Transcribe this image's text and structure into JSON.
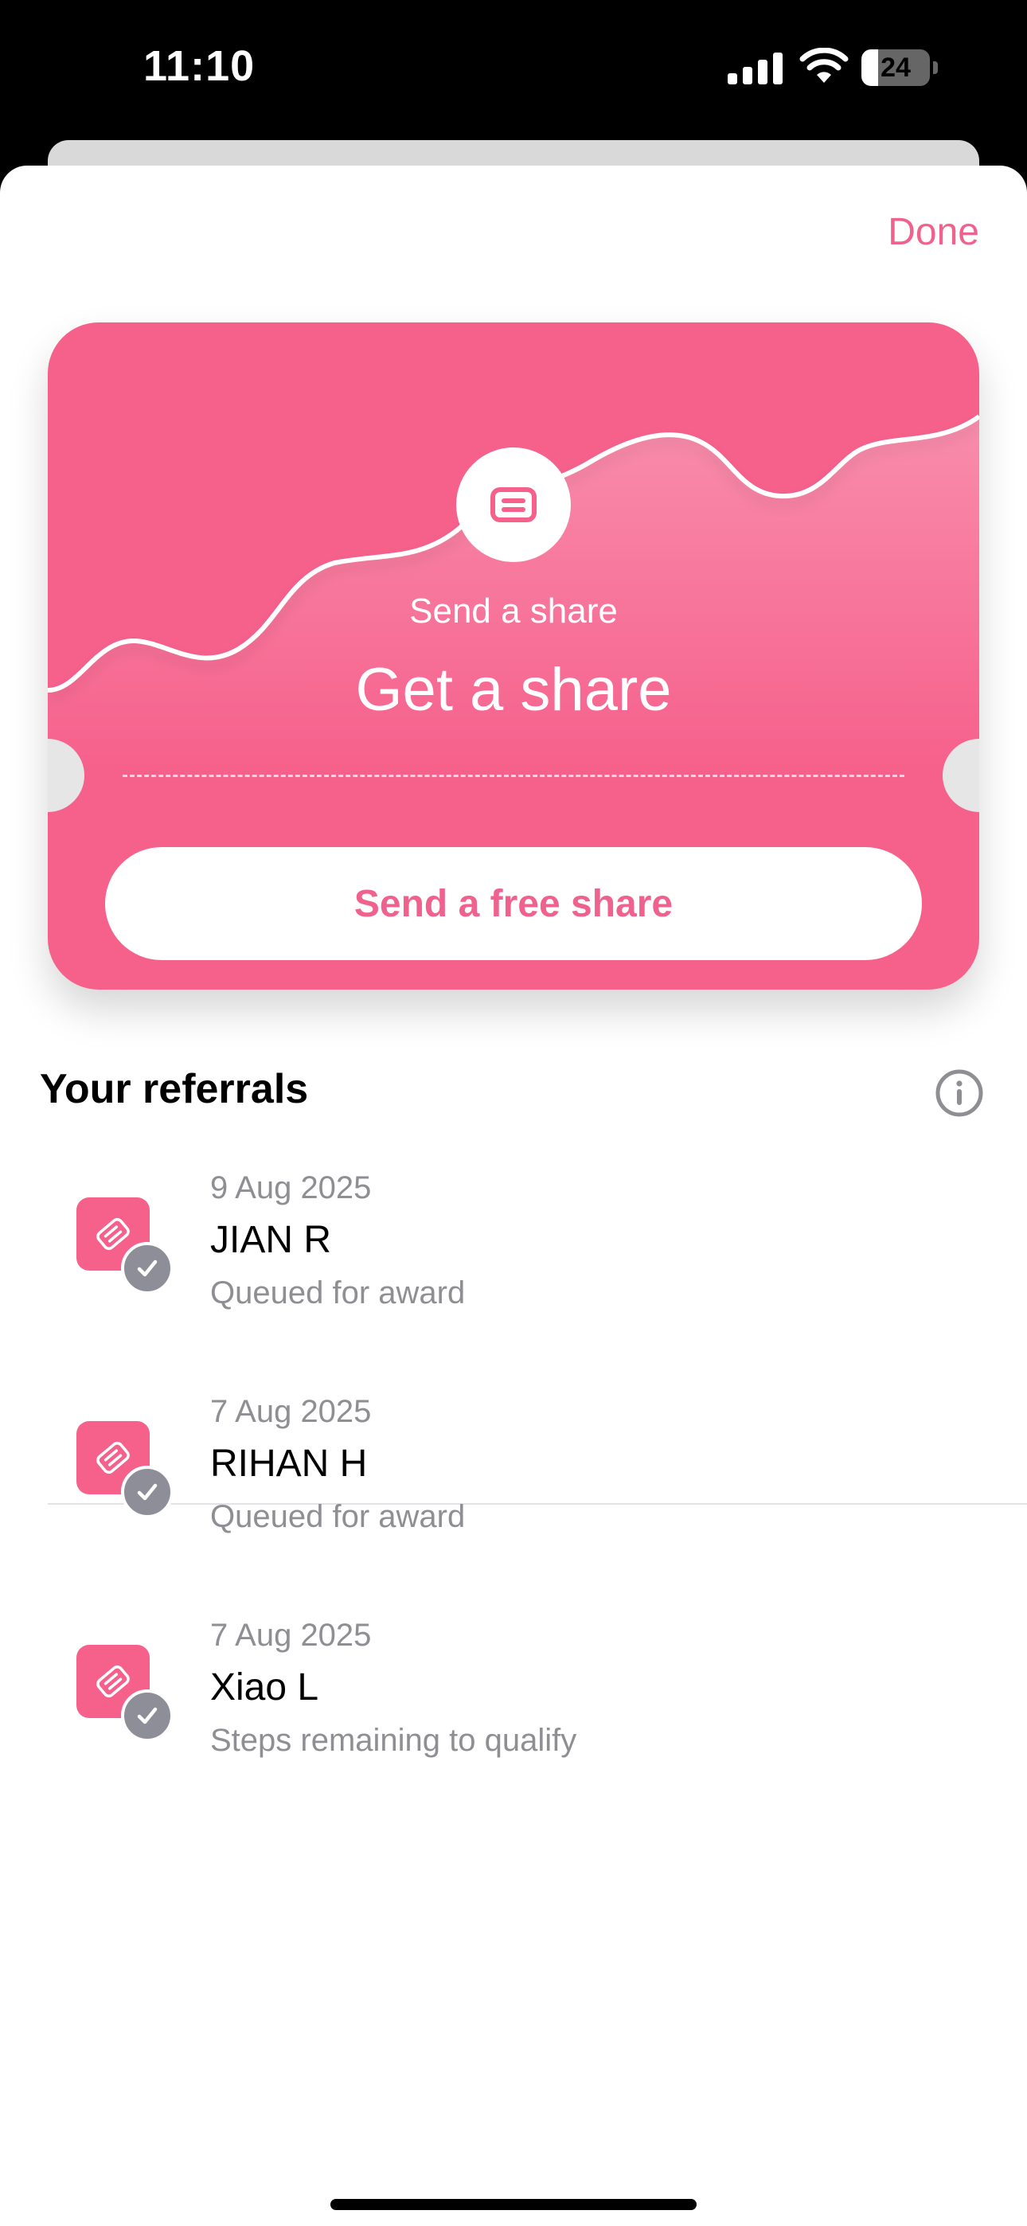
{
  "status_bar": {
    "time": "11:10",
    "battery": "24",
    "battery_level": 0.24
  },
  "sheet": {
    "done_label": "Done"
  },
  "ticket": {
    "subtitle": "Send a share",
    "title": "Get a share",
    "button_label": "Send a free share",
    "badge_icon": "share-ticket-icon",
    "color": "#f6618c"
  },
  "referrals": {
    "title": "Your referrals",
    "info_icon": "info-icon",
    "items": [
      {
        "date": "9 Aug 2025",
        "name": "JIAN R",
        "status": "Queued for award"
      },
      {
        "date": "7 Aug 2025",
        "name": "RIHAN H",
        "status": "Queued for award"
      },
      {
        "date": "7 Aug 2025",
        "name": "Xiao L",
        "status": "Steps remaining to qualify"
      }
    ]
  },
  "colors": {
    "accent": "#f0628e",
    "secondary_text": "#8e8e93"
  }
}
